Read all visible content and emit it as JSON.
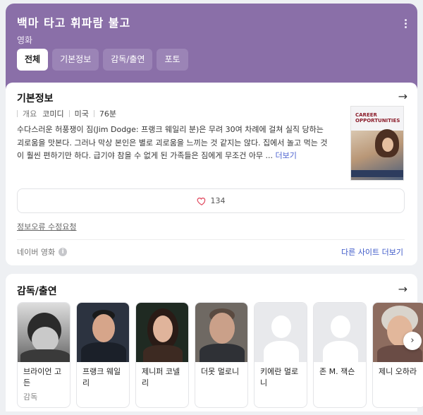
{
  "header": {
    "title": "백마 타고 휘파람 불고",
    "category": "영화",
    "tabs": [
      {
        "label": "전체",
        "active": true
      },
      {
        "label": "기본정보",
        "active": false
      },
      {
        "label": "감독/출연",
        "active": false
      },
      {
        "label": "포토",
        "active": false
      }
    ],
    "accent_color": "#8a6fa8"
  },
  "basic_info": {
    "section_title": "기본정보",
    "meta": [
      "개요",
      "코미디",
      "미국",
      "76분"
    ],
    "description": "수다스러운 허풍쟁이 짐(Jim Dodge: 프랭크 웨일리 분)은 무려 30여 차례에 걸쳐 실직 당하는 괴로움을 맛본다. 그러나 막상 본인은 별로 괴로움을 느끼는 것 같지는 않다. 집에서 놀고 먹는 것이 훨씬 편하기만 하다. 급기야 참을 수 없게 된 가족들은 짐에게 무조건 아무 ...",
    "more_link": "더보기",
    "poster_title": "CAREER OPPORTUNITIES",
    "like_count": "134",
    "report_link": "정보오류 수정요청",
    "source_label": "네이버 영화",
    "other_sites": "다른 사이트 더보기"
  },
  "cast_section": {
    "section_title": "감독/출연",
    "people": [
      {
        "name": "브라이언 고든",
        "role": "감독"
      },
      {
        "name": "프랭크 웨일리",
        "role": ""
      },
      {
        "name": "제니퍼 코넬리",
        "role": ""
      },
      {
        "name": "더못 멀로니",
        "role": ""
      },
      {
        "name": "키에란 멀로니",
        "role": ""
      },
      {
        "name": "존 M. 잭슨",
        "role": ""
      },
      {
        "name": "제니 오하라",
        "role": ""
      }
    ]
  }
}
